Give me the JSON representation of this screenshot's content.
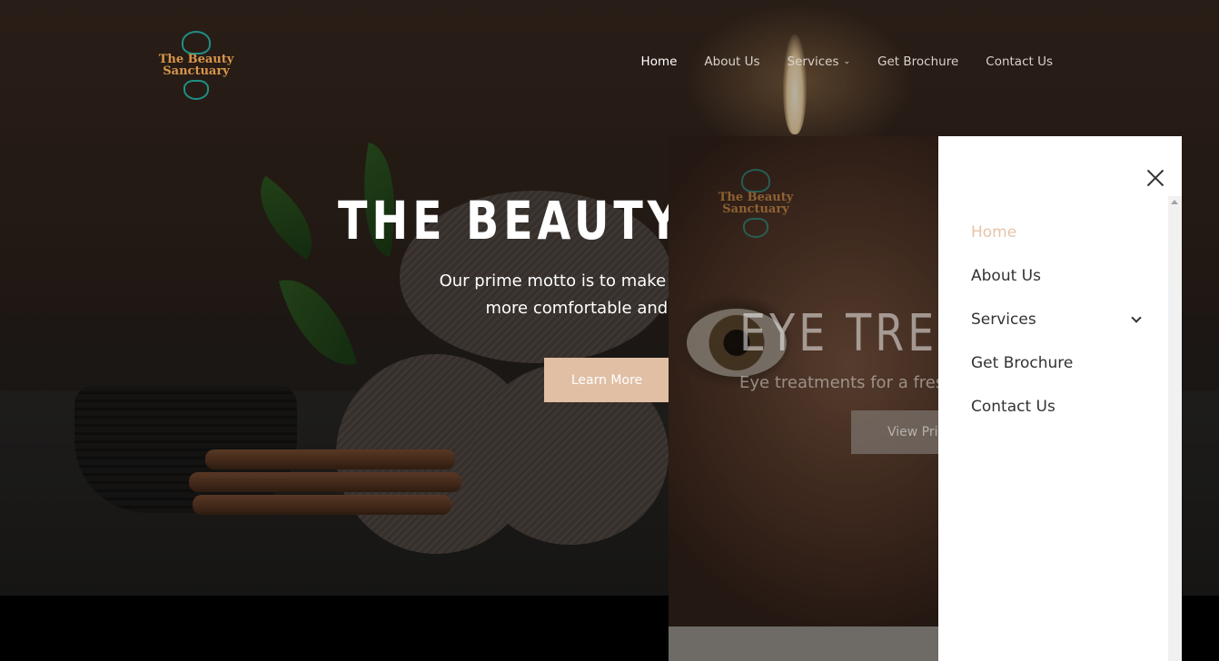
{
  "brand": {
    "logo_text": "The Beauty Sanctuary"
  },
  "nav": {
    "items": [
      {
        "label": "Home",
        "active": true
      },
      {
        "label": "About Us"
      },
      {
        "label": "Services",
        "has_dropdown": true
      },
      {
        "label": "Get Brochure"
      },
      {
        "label": "Contact Us"
      }
    ]
  },
  "hero": {
    "title": "THE BEAUTY SANCTUARY",
    "subtitle_line1": "Our prime motto is to make our clients look",
    "subtitle_line2": "more comfortable and confident",
    "button_label": "Learn More"
  },
  "slide2": {
    "logo_text": "The Beauty Sanctuary",
    "title": "EYE TREATMENTS",
    "subtitle": "Eye treatments for a fresh look",
    "button_label": "View Prices"
  },
  "drawer": {
    "items": [
      {
        "label": "Home",
        "active": true
      },
      {
        "label": "About Us"
      },
      {
        "label": "Services",
        "has_dropdown": true
      },
      {
        "label": "Get Brochure"
      },
      {
        "label": "Contact Us"
      }
    ]
  },
  "colors": {
    "accent": "#e0bfa4",
    "drawer_active": "#e6c4a8",
    "logo_gold": "#d8974a",
    "logo_teal": "#1e8f85"
  }
}
